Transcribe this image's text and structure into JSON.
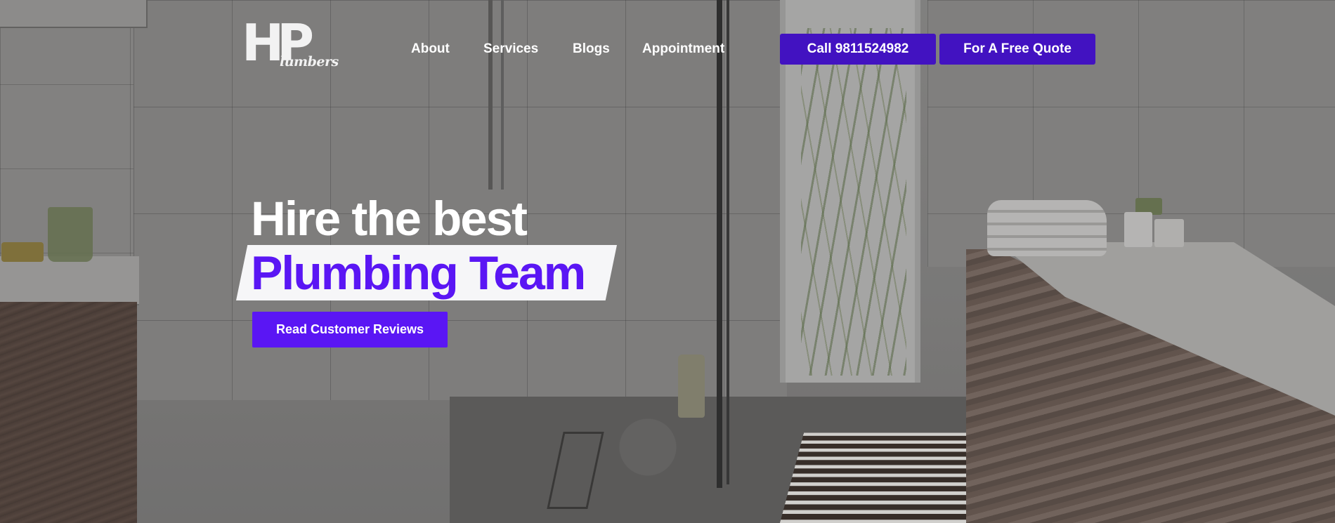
{
  "logo": {
    "mark": "HP",
    "wordmark": "lumbers"
  },
  "nav": {
    "about": "About",
    "services": "Services",
    "blogs": "Blogs",
    "appointment": "Appointment"
  },
  "header_buttons": {
    "call": "Call 9811524982",
    "quote": "For A Free Quote"
  },
  "hero": {
    "line1": "Hire the best",
    "line2": "Plumbing Team",
    "cta": "Read Customer Reviews"
  },
  "colors": {
    "accent": "#5a16f4",
    "header_button": "#4212c1",
    "highlight_bg": "#f6f6f8"
  }
}
